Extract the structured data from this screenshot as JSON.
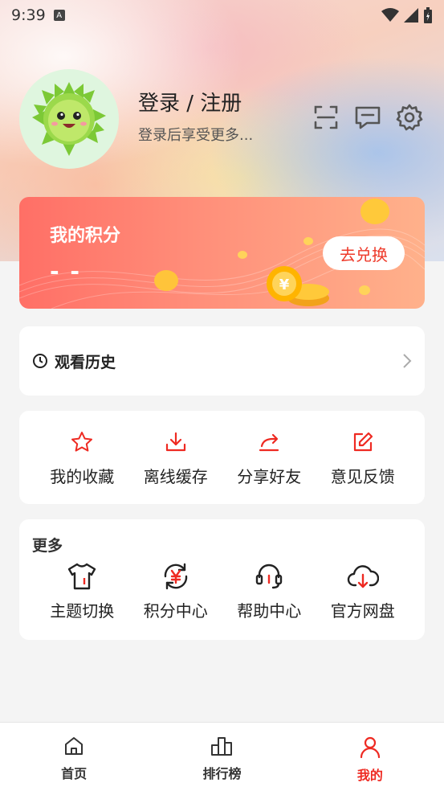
{
  "status_bar": {
    "time": "9:39",
    "icons": [
      "a-notification-icon",
      "wifi-icon",
      "signal-icon",
      "battery-icon"
    ]
  },
  "profile": {
    "title": "登录 / 注册",
    "subtitle": "登录后享受更多...",
    "avatar": "durian-mascot-avatar"
  },
  "header_icons": [
    "scan-icon",
    "message-icon",
    "settings-icon"
  ],
  "points": {
    "title": "我的积分",
    "value": "- -",
    "button": "去兑换"
  },
  "history": {
    "label": "观看历史",
    "icon": "clock-icon"
  },
  "actions": [
    {
      "label": "我的收藏",
      "icon": "star-icon"
    },
    {
      "label": "离线缓存",
      "icon": "download-icon"
    },
    {
      "label": "分享好友",
      "icon": "share-icon"
    },
    {
      "label": "意见反馈",
      "icon": "edit-icon"
    }
  ],
  "more": {
    "title": "更多",
    "items": [
      {
        "label": "主题切换",
        "icon": "tshirt-icon"
      },
      {
        "label": "积分中心",
        "icon": "points-yen-icon"
      },
      {
        "label": "帮助中心",
        "icon": "headset-icon"
      },
      {
        "label": "官方网盘",
        "icon": "cloud-download-icon"
      }
    ]
  },
  "tabbar": {
    "active": "我的",
    "tabs": [
      {
        "label": "首页",
        "icon": "home-icon"
      },
      {
        "label": "排行榜",
        "icon": "ranking-icon"
      },
      {
        "label": "我的",
        "icon": "person-icon"
      }
    ]
  },
  "colors": {
    "accent": "#ee2a22",
    "points_card_start": "#ff6f66",
    "points_card_end": "#ffb18b",
    "background": "#f4f4f4"
  }
}
